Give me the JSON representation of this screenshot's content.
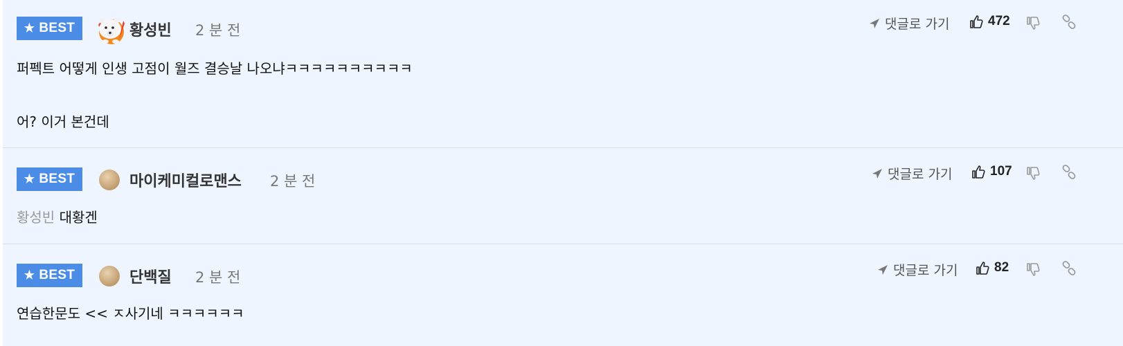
{
  "comments": [
    {
      "badge": "BEST",
      "username": "황성빈",
      "time": "2 분 전",
      "goto_label": "댓글로 가기",
      "likes": "472",
      "lines": [
        "퍼펙트 어떻게 인생 고점이 월즈 결승날 나오냐ㅋㅋㅋㅋㅋㅋㅋㅋㅋㅋ",
        "어? 이거 본건데"
      ]
    },
    {
      "badge": "BEST",
      "username": "마이케미컬로맨스",
      "time": "2 분 전",
      "goto_label": "댓글로 가기",
      "likes": "107",
      "reply_to": "황성빈",
      "text": "대황겐"
    },
    {
      "badge": "BEST",
      "username": "단백질",
      "time": "2 분 전",
      "goto_label": "댓글로 가기",
      "likes": "82",
      "text": "연습한문도 << ㅈ사기네 ㅋㅋㅋㅋㅋㅋ"
    }
  ],
  "colors": {
    "background": "#eef5ff",
    "badge": "#4b8de6",
    "divider": "#d8dde6"
  }
}
